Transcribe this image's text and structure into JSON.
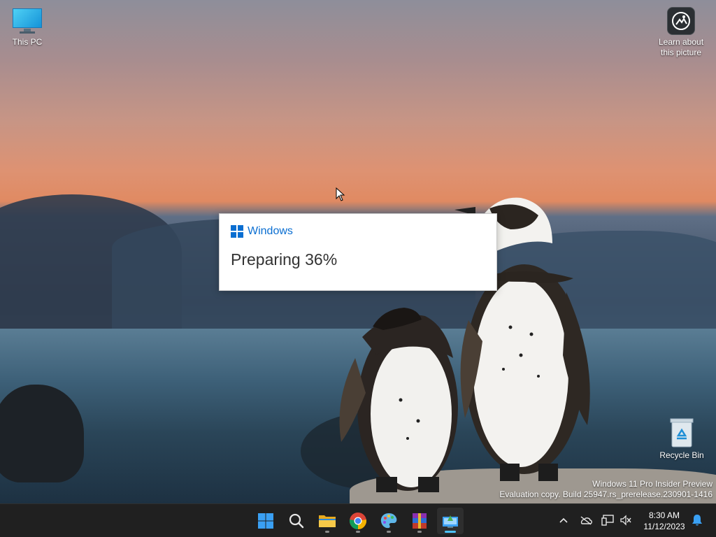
{
  "desktop": {
    "icons": [
      {
        "label": "This PC"
      },
      {
        "label": "Learn about this picture"
      },
      {
        "label": "Recycle Bin"
      }
    ],
    "watermark": {
      "line1": "Windows 11 Pro Insider Preview",
      "line2": "Evaluation copy. Build 25947.rs_prerelease.230901-1416"
    }
  },
  "dialog": {
    "brand": "Windows",
    "status": "Preparing 36%",
    "progress_percent": 36
  },
  "taskbar": {
    "apps": [
      {
        "icon": "start-icon"
      },
      {
        "icon": "search-icon"
      },
      {
        "icon": "file-explorer-icon"
      },
      {
        "icon": "chrome-icon"
      },
      {
        "icon": "paint-icon"
      },
      {
        "icon": "winrar-icon"
      },
      {
        "icon": "setup-icon",
        "active": true
      }
    ],
    "tray": {
      "icons": [
        "chevron-up-icon",
        "onedrive-icon",
        "network-icon",
        "volume-muted-icon",
        "notification-bell-icon"
      ],
      "time": "8:30 AM",
      "date": "11/12/2023"
    }
  },
  "colors": {
    "taskbar_bg": "#202020",
    "accent": "#0a6ed1",
    "active_indicator": "#4cc2ff"
  }
}
